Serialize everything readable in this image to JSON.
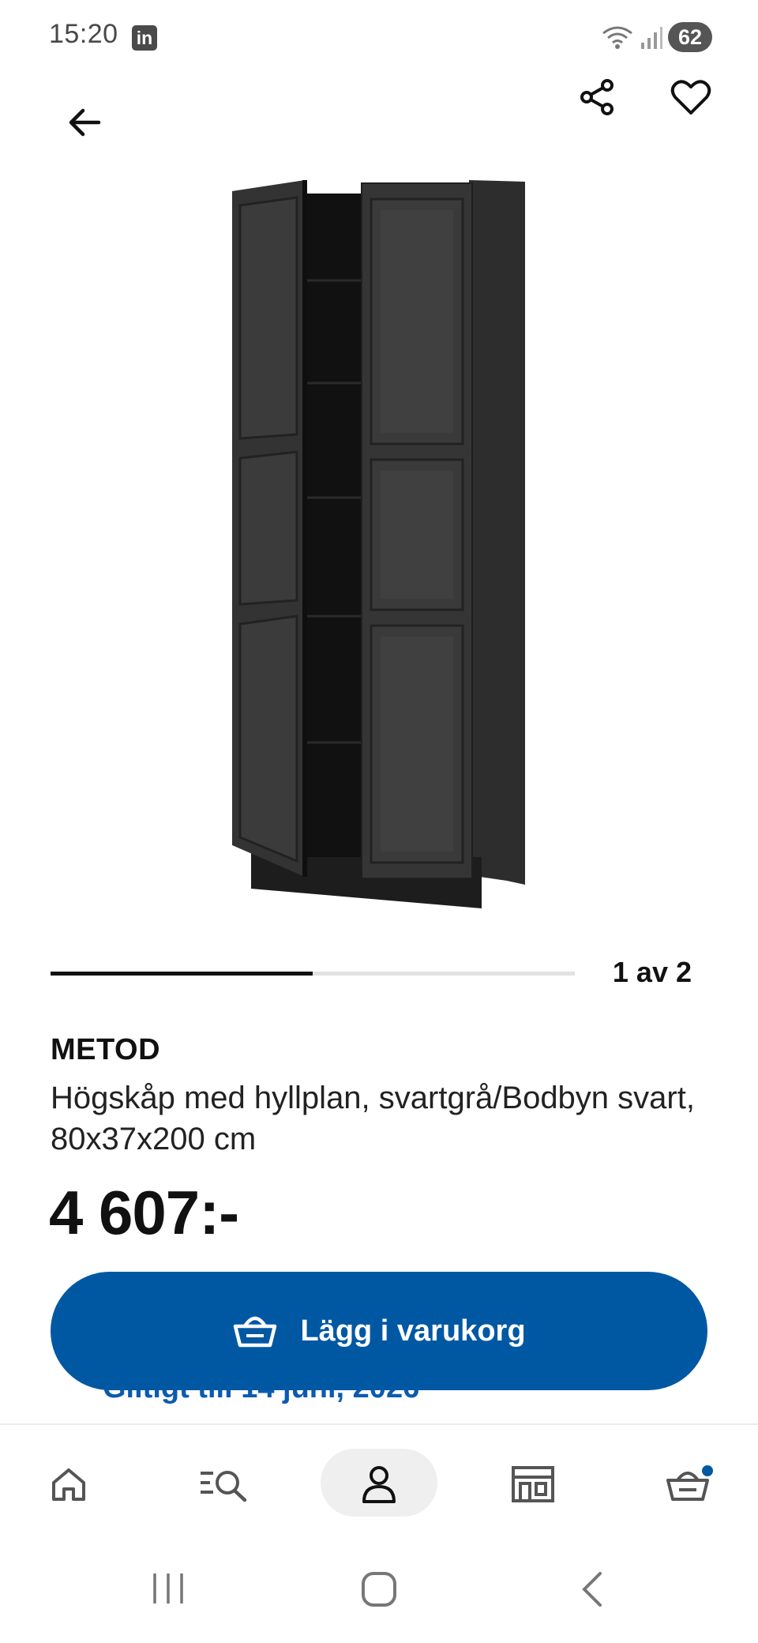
{
  "status_bar": {
    "time": "15:20",
    "app_badge": "in",
    "battery": "62"
  },
  "icons": {
    "back": "arrow-left-icon",
    "share": "share-icon",
    "wishlist": "heart-icon",
    "cart": "basket-icon"
  },
  "carousel": {
    "counter": "1 av 2",
    "progress": 0.5
  },
  "product": {
    "name": "METOD",
    "description": "Högskåp med hyllplan, svartgrå/Bodbyn svart, 80x37x200 cm",
    "price": "4 607:-"
  },
  "partially_hidden_text": "Giltigt till 14 juni, 2026",
  "cta": {
    "label": "Lägg i varukorg"
  },
  "bottom_nav": [
    {
      "name": "home",
      "icon": "home-icon"
    },
    {
      "name": "search",
      "icon": "search-list-icon"
    },
    {
      "name": "profile",
      "icon": "person-icon",
      "active": true
    },
    {
      "name": "stores",
      "icon": "store-icon"
    },
    {
      "name": "cart",
      "icon": "basket-icon",
      "badge": true
    }
  ],
  "colors": {
    "accent": "#0058a3",
    "badge": "#0058a3",
    "text": "#111111"
  }
}
